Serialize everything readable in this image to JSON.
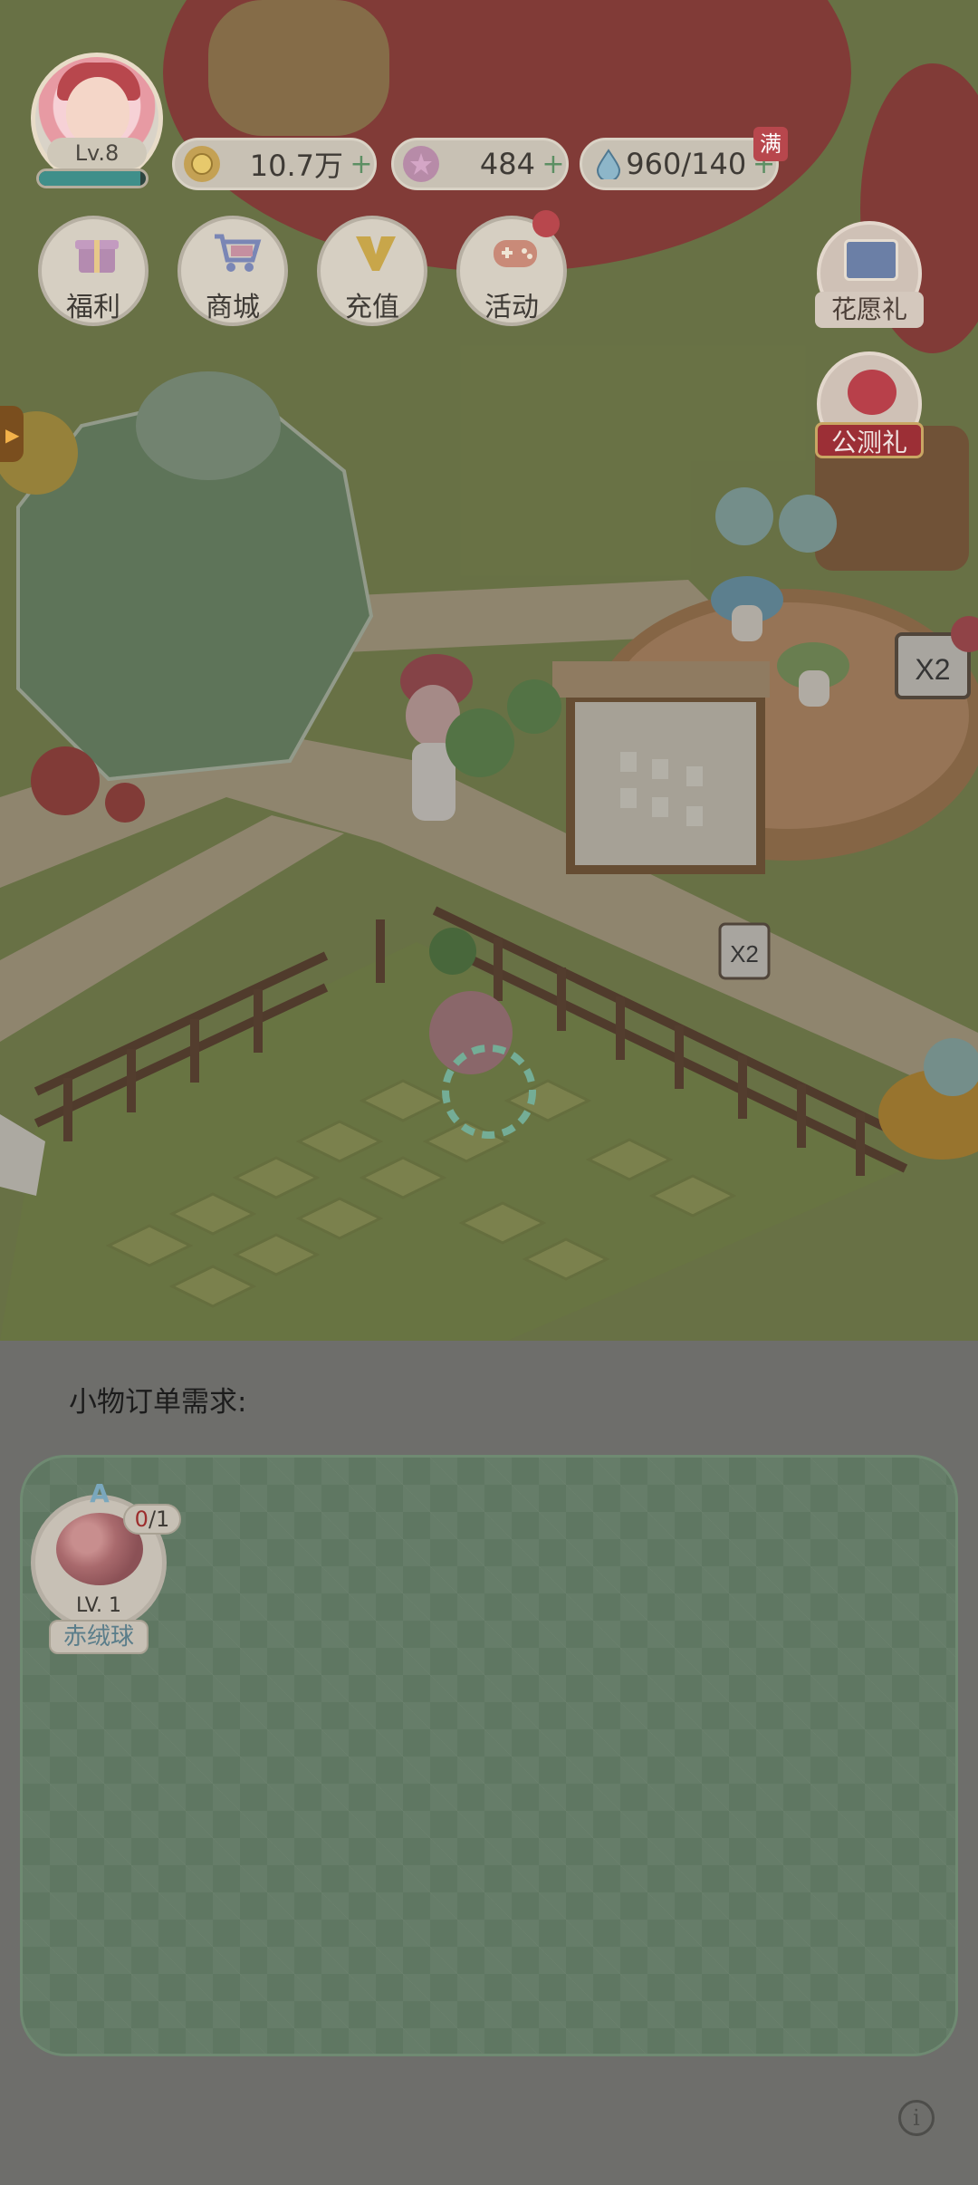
{
  "player": {
    "level_label": "Lv.8",
    "exp_progress": 0.95
  },
  "resources": {
    "coins": {
      "icon": "coin-icon",
      "value": "10.7万"
    },
    "gems": {
      "icon": "star-gem-icon",
      "value": "484"
    },
    "water": {
      "icon": "water-drop-icon",
      "value": "960/140",
      "full_badge": "满"
    }
  },
  "menu": [
    {
      "label": "福利",
      "icon": "gift-icon"
    },
    {
      "label": "商城",
      "icon": "shopping-cart-icon"
    },
    {
      "label": "充值",
      "icon": "v-recharge-icon"
    },
    {
      "label": "活动",
      "icon": "gamepad-icon"
    }
  ],
  "side_buttons": {
    "wish_gift": {
      "label": "花愿礼",
      "icon": "photos-icon"
    },
    "beta_gift": {
      "label": "公测礼",
      "icon": "apple-icon"
    }
  },
  "scene": {
    "signs": [
      "X2",
      "X2"
    ]
  },
  "order_panel": {
    "title": "小物订单需求:",
    "orders": [
      {
        "grade": "A",
        "progress_current": "0",
        "progress_total": "/1",
        "level": "LV. 1",
        "name": "赤绒球",
        "icon": "red-pompom-flower-icon"
      }
    ]
  },
  "colors": {
    "panel_bg": "#6e6e6b",
    "orders_box": "#5f7762",
    "progress_current": "#9c2d2d"
  }
}
